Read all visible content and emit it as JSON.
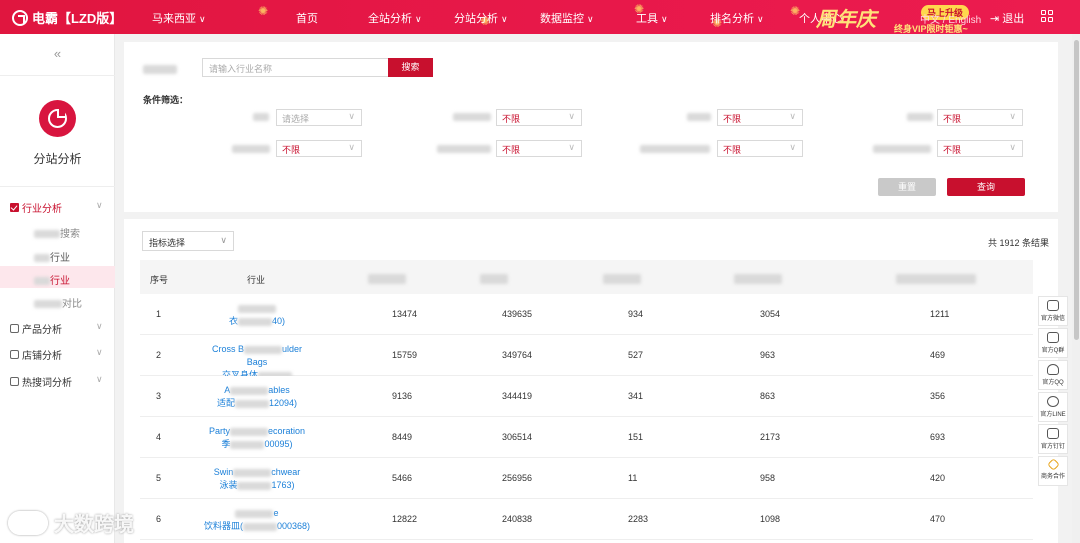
{
  "brand": {
    "name": "电霸【LZD版】"
  },
  "nav": {
    "region": "马来西亚",
    "home": "首页",
    "site_analysis": "全站分析",
    "sub_site_analysis": "分站分析",
    "data_monitor": "数据监控",
    "tools": "工具",
    "ranking": "排名分析",
    "personal": "个人中心",
    "lang": "中文 / English",
    "logout": "退出"
  },
  "promo": {
    "title": "周年庆",
    "button": "马上升级",
    "subtitle": "终身VIP限时钜惠~"
  },
  "sidebar": {
    "title": "分站分析",
    "menu": [
      {
        "label": "行业分析",
        "expanded": true
      },
      {
        "label": "产品分析"
      },
      {
        "label": "店铺分析"
      },
      {
        "label": "热搜词分析"
      }
    ],
    "subitems": [
      "行业",
      "行业"
    ]
  },
  "search": {
    "placeholder": "请输入行业名称",
    "button": "搜索"
  },
  "filters": {
    "title": "条件筛选：",
    "row1": [
      "请选择",
      "不限",
      "不限",
      "不限"
    ],
    "row2": [
      "不限",
      "不限",
      "不限",
      "不限"
    ],
    "reset": "重置",
    "query": "查询"
  },
  "table": {
    "metric_select": "指标选择",
    "total": "共 1912 条结果",
    "headers": {
      "index": "序号",
      "industry": "行业"
    },
    "rows": [
      {
        "idx": "1",
        "l1": "",
        "l2": "衣",
        "l2b": "40)",
        "c1": "13474",
        "c2": "439635",
        "c3": "934",
        "c4": "3054",
        "c5": "1211"
      },
      {
        "idx": "2",
        "l1": "Cross B",
        "l1b": "ulder Bags",
        "l2": "交叉身体",
        "l2b": "10001954)",
        "c1": "15759",
        "c2": "349764",
        "c3": "527",
        "c4": "963",
        "c5": "469"
      },
      {
        "idx": "3",
        "l1": "A",
        "l1b": "ables",
        "l2": "适配",
        "l2b": "12094)",
        "c1": "9136",
        "c2": "344419",
        "c3": "341",
        "c4": "863",
        "c5": "356"
      },
      {
        "idx": "4",
        "l1": "Party",
        "l1b": "ecoration",
        "l2": "季",
        "l2b": "00095)",
        "c1": "8449",
        "c2": "306514",
        "c3": "151",
        "c4": "2173",
        "c5": "693"
      },
      {
        "idx": "5",
        "l1": "Swin",
        "l1b": "chwear",
        "l2": "泳装",
        "l2b": "1763)",
        "c1": "5466",
        "c2": "256956",
        "c3": "11",
        "c4": "958",
        "c5": "420"
      },
      {
        "idx": "6",
        "l1": "",
        "l1b": "e",
        "l2": "饮料器皿(",
        "l2b": "000368)",
        "c1": "12822",
        "c2": "240838",
        "c3": "2283",
        "c4": "1098",
        "c5": "470"
      }
    ]
  },
  "float_bar": [
    "官方微信",
    "官方Q群",
    "官方QQ",
    "官方LINE",
    "官方钉钉",
    "商务合作"
  ],
  "watermark": "大数跨境"
}
